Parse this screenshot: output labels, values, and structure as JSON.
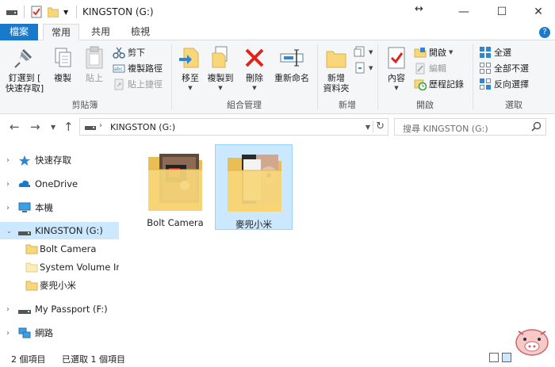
{
  "window": {
    "title": "KINGSTON (G:)",
    "minimize": "—",
    "maximize": "☐",
    "close": "✕"
  },
  "tabs": [
    {
      "label": "檔案"
    },
    {
      "label": "常用"
    },
    {
      "label": "共用"
    },
    {
      "label": "檢視"
    }
  ],
  "ribbon": {
    "clipboard": {
      "pin": "釘選到 [",
      "pin2": "快速存取]",
      "copy": "複製",
      "paste": "貼上",
      "cut": "剪下",
      "copy_path": "複製路徑",
      "paste_shortcut": "貼上捷徑",
      "label": "剪貼簿"
    },
    "organize": {
      "move_to": "移至",
      "copy_to": "複製到",
      "delete": "刪除",
      "rename": "重新命名",
      "label": "組合管理"
    },
    "new": {
      "new_folder": "新增",
      "new_folder2": "資料夾",
      "label": "新增"
    },
    "open": {
      "properties": "內容",
      "open": "開啟",
      "edit": "編輯",
      "history": "歷程記錄",
      "label": "開啟"
    },
    "select": {
      "select_all": "全選",
      "select_none": "全部不選",
      "invert": "反向選擇",
      "label": "選取"
    }
  },
  "address": {
    "path": "KINGSTON (G:)",
    "search_placeholder": "搜尋 KINGSTON (G:)"
  },
  "nav": {
    "quick_access": "快速存取",
    "onedrive": "OneDrive",
    "this_pc": "本機",
    "kingston": "KINGSTON (G:)",
    "bolt_camera": "Bolt Camera",
    "system_volume": "System Volume Information",
    "xiaomi": "麥兜小米",
    "my_passport": "My Passport (F:)",
    "network": "網路"
  },
  "content": {
    "items": [
      {
        "label": "Bolt Camera"
      },
      {
        "label": "麥兜小米"
      }
    ]
  },
  "status": {
    "count": "2 個項目",
    "selected": "已選取 1 個項目"
  },
  "colors": {
    "accent": "#1979ca",
    "selection": "#cce8ff",
    "folder": "#f7d77a"
  }
}
